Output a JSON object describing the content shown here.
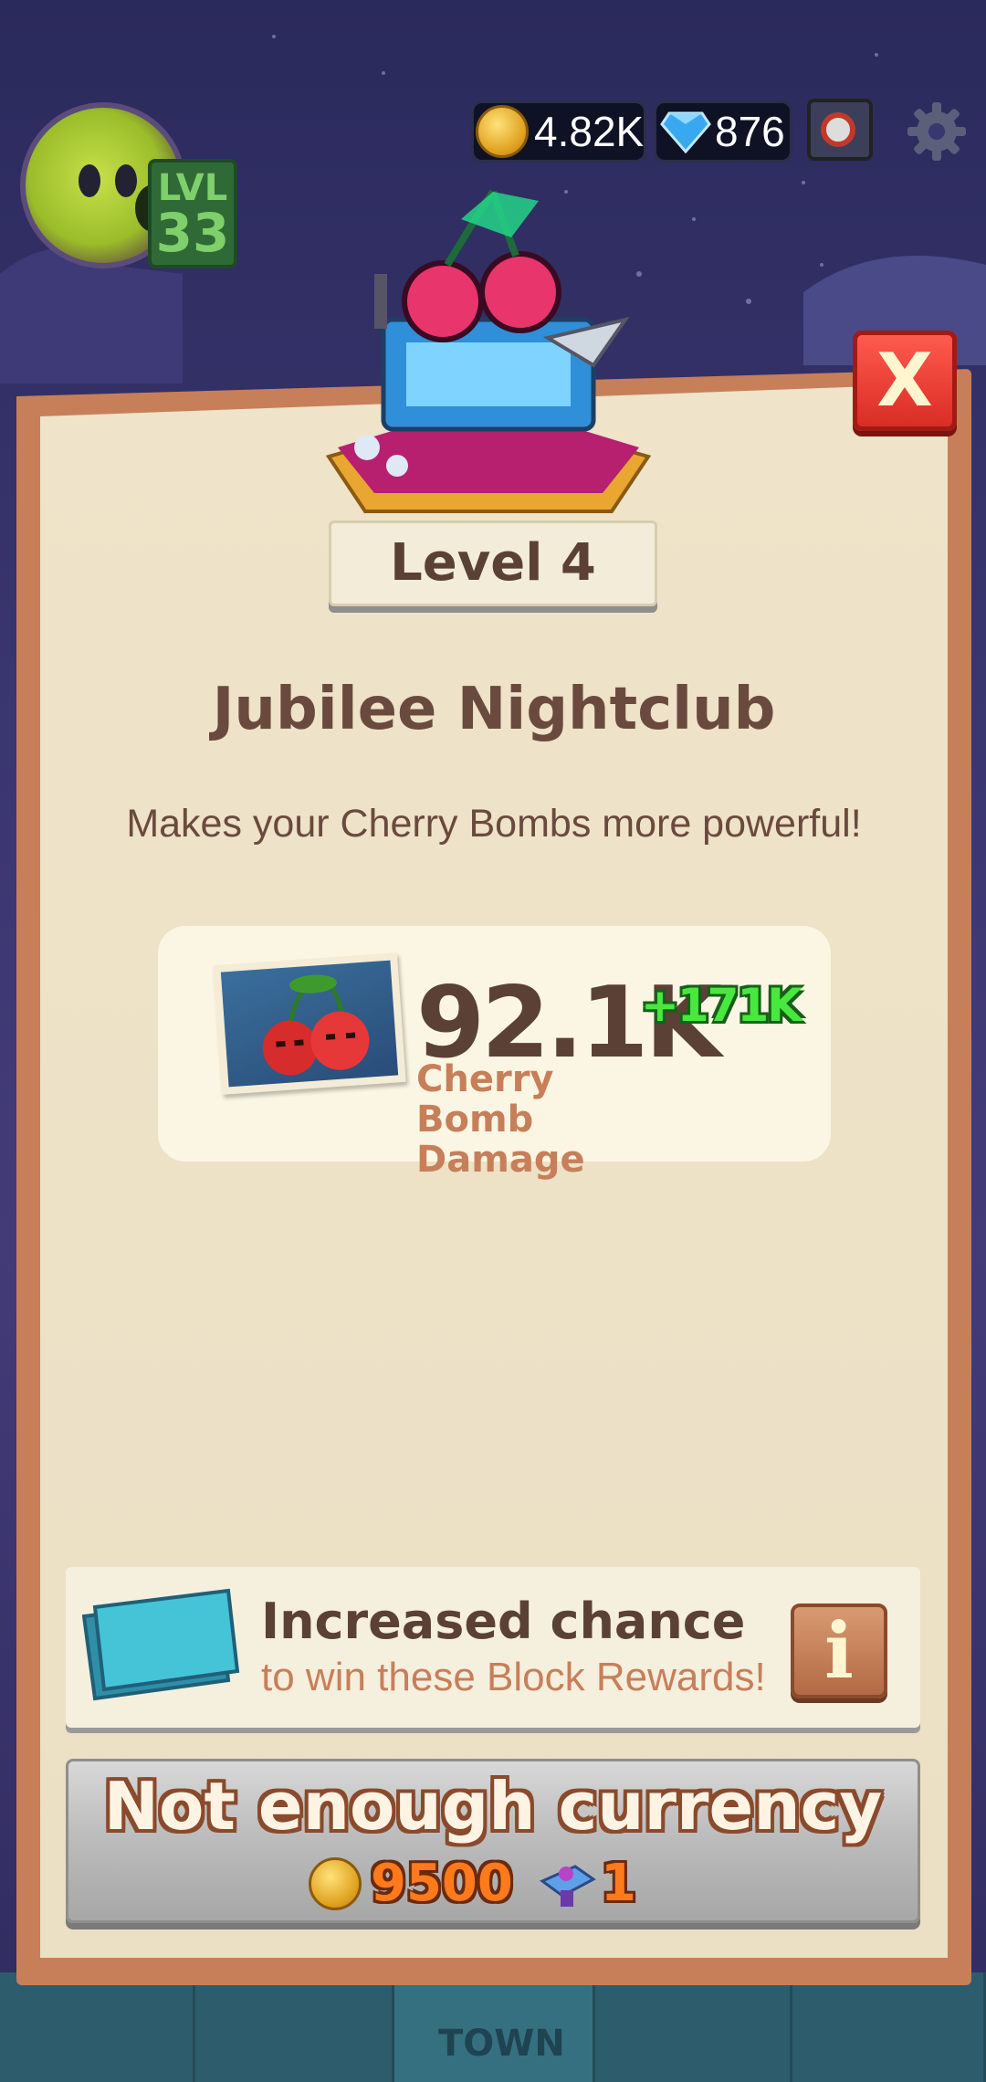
{
  "hud": {
    "player_level_prefix": "LVL",
    "player_level": "33",
    "coins": "4.82K",
    "gems": "876",
    "icons": [
      "coin-icon",
      "gem-icon",
      "safe-icon",
      "gear-icon"
    ]
  },
  "dialog": {
    "close_label": "X",
    "level_label": "Level 4",
    "title": "Jubilee Nightclub",
    "description": "Makes your Cherry Bombs more powerful!",
    "stat": {
      "value": "92.1K",
      "bonus": "+171K",
      "label_line1": "Cherry Bomb",
      "label_line2": "Damage",
      "icon": "cherry-bomb-icon"
    },
    "reward": {
      "title": "Increased chance",
      "subtitle": "to win these Block Rewards!",
      "info_label": "i"
    },
    "purchase": {
      "label": "Not enough currency",
      "coin_cost": "9500",
      "token_cost": "1"
    }
  },
  "bottom_nav": {
    "town_label": "TOWN"
  },
  "colors": {
    "panel_border": "#c77f5a",
    "panel_fill": "#ebdfc4",
    "text_brown": "#6a4a3e",
    "accent_green": "#49e83f",
    "close_red": "#d92d25",
    "cost_orange": "#ff7a1a"
  }
}
